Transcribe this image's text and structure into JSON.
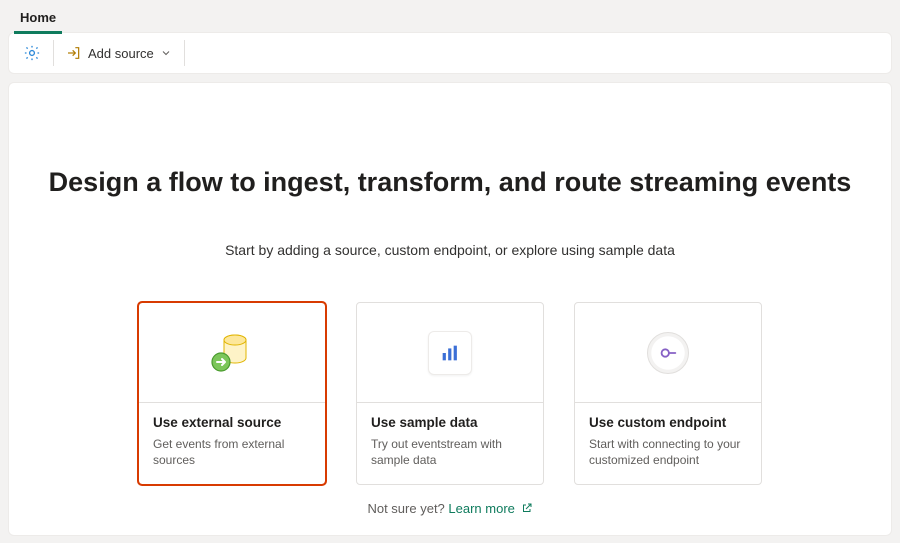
{
  "tabs": {
    "home": "Home"
  },
  "toolbar": {
    "add_source_label": "Add source"
  },
  "hero": {
    "headline": "Design a flow to ingest, transform, and route streaming events",
    "subhead": "Start by adding a source, custom endpoint, or explore using sample data"
  },
  "cards": [
    {
      "title": "Use external source",
      "desc": "Get events from external sources",
      "highlight": true
    },
    {
      "title": "Use sample data",
      "desc": "Try out eventstream with sample data",
      "highlight": false
    },
    {
      "title": "Use custom endpoint",
      "desc": "Start with connecting to your customized endpoint",
      "highlight": false
    }
  ],
  "footer": {
    "prefix": "Not sure yet? ",
    "link": "Learn more"
  }
}
